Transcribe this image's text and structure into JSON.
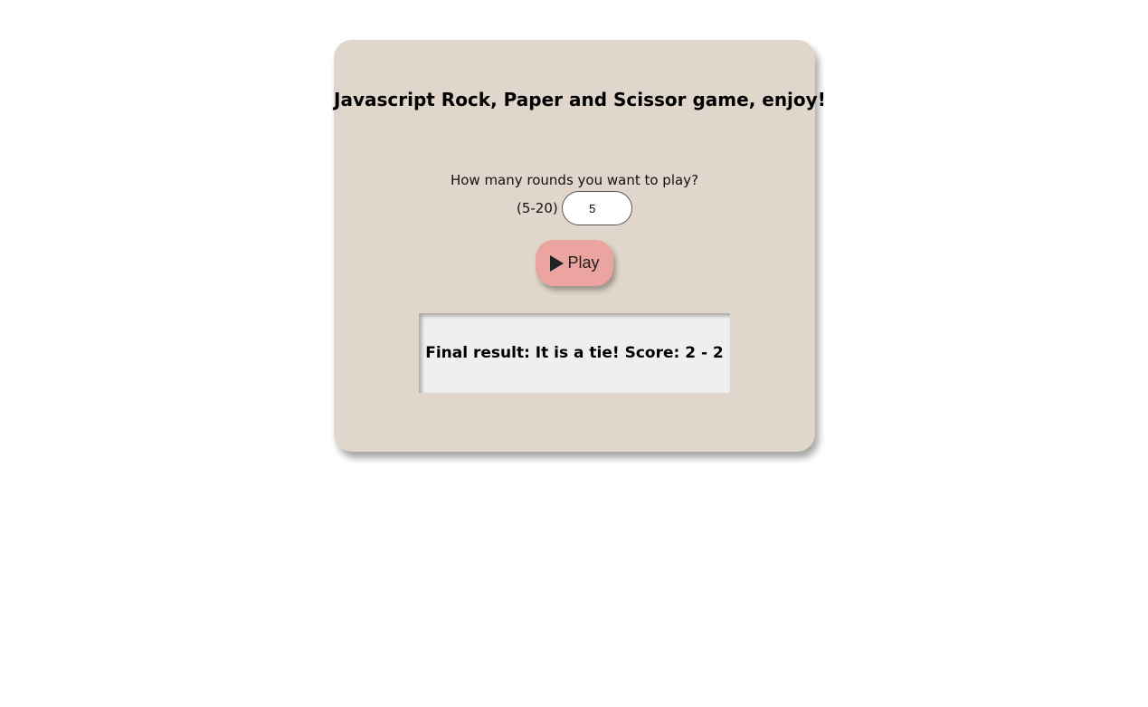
{
  "game": {
    "title": "Javascript Rock, Paper and Scissor game, enjoy!",
    "question": "How many rounds you want to play?",
    "range_label": "(5-20)",
    "rounds_value": "5",
    "play_label": "Play",
    "result_text": "Final result: It is a tie! Score: 2 - 2"
  },
  "icons": {
    "play": "play-triangle-icon"
  },
  "colors": {
    "card_background": "#e0d6cb",
    "play_button": "#eba49f",
    "result_background": "#efefef"
  }
}
